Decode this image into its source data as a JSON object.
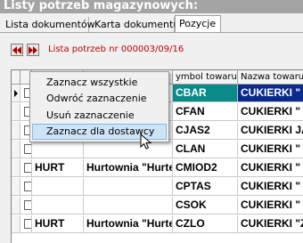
{
  "window": {
    "title": "Listy potrzeb magazynowych:"
  },
  "tabs": [
    {
      "label": "Lista dokumentów"
    },
    {
      "label": "Karta dokumentu"
    },
    {
      "label": "Pozycje"
    }
  ],
  "toolbar": {
    "list_info": "Lista potrzeb nr 000003/09/16"
  },
  "grid": {
    "headers": [
      "ymbol towaru",
      "Nazwa towaru"
    ],
    "rows": [
      {
        "c1": "",
        "c2": "",
        "symbol": "CBAR",
        "name": "CUKIERKI \"",
        "selected": true
      },
      {
        "c1": "",
        "c2": "",
        "symbol": "CFAN",
        "name": "CUKIERKI \"",
        "selected": false
      },
      {
        "c1": "",
        "c2": "",
        "symbol": "CJAS2",
        "name": "CUKIERKI JA",
        "selected": false
      },
      {
        "c1": "",
        "c2": "",
        "symbol": "CLAN",
        "name": "CUKIERKI \"",
        "selected": false
      },
      {
        "c1": "HURT",
        "c2": "Hurtownia \"Hurte",
        "symbol": "CMIOD2",
        "name": "CUKIERKI \"",
        "selected": false
      },
      {
        "c1": "",
        "c2": "",
        "symbol": "CPTAS",
        "name": "CUKIERKI \"",
        "selected": false
      },
      {
        "c1": "",
        "c2": "",
        "symbol": "CSOK",
        "name": "CUKIERKI \"",
        "selected": false
      },
      {
        "c1": "HURT",
        "c2": "Hurtownia \"Hurte",
        "symbol": "CZLO",
        "name": "CUKIERKI \"Z",
        "selected": false
      }
    ]
  },
  "context_menu": {
    "items": [
      {
        "label": "Zaznacz wszystkie"
      },
      {
        "label": "Odwróć zaznaczenie"
      },
      {
        "label": "Usuń zaznaczenie"
      },
      {
        "label": "Zaznacz dla dostawcy"
      }
    ]
  },
  "colors": {
    "selected_cell": "#0b8a8a",
    "name_selected": "#0a2a8c",
    "menu_highlight": "#cde4f7",
    "list_info": "#c00000"
  }
}
